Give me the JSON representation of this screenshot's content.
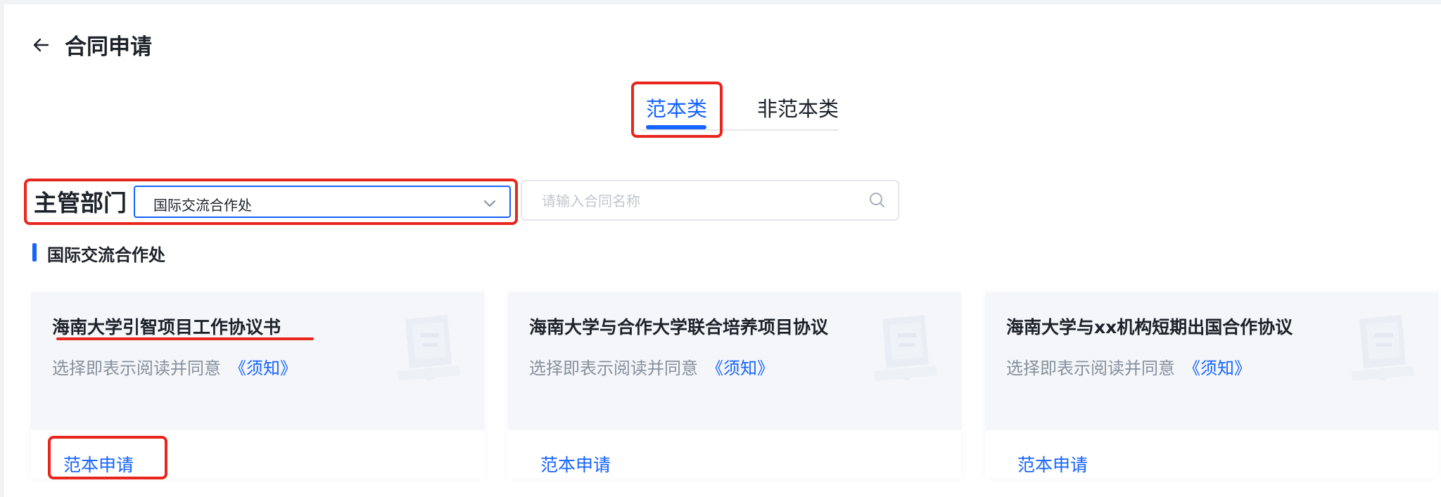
{
  "header": {
    "title": "合同申请"
  },
  "tabs": [
    {
      "label": "范本类",
      "active": true
    },
    {
      "label": "非范本类",
      "active": false
    }
  ],
  "filter": {
    "label": "主管部门",
    "selected_department": "国际交流合作处",
    "search_placeholder": "请输入合同名称"
  },
  "section": {
    "title": "国际交流合作处"
  },
  "cards": [
    {
      "title": "海南大学引智项目工作协议书",
      "notice_text": "选择即表示阅读并同意",
      "notice_link": "《须知》",
      "apply_label": "范本申请"
    },
    {
      "title": "海南大学与合作大学联合培养项目协议",
      "notice_text": "选择即表示阅读并同意",
      "notice_link": "《须知》",
      "apply_label": "范本申请"
    },
    {
      "title": "海南大学与xx机构短期出国合作协议",
      "notice_text": "选择即表示阅读并同意",
      "notice_link": "《须知》",
      "apply_label": "范本申请"
    }
  ],
  "colors": {
    "accent": "#1664ff",
    "annotation": "#e8261d",
    "text_primary": "#1d2129",
    "text_secondary": "#86909c"
  },
  "icons": [
    "arrow-left-icon",
    "chevron-down-icon",
    "search-icon",
    "doc-illustration-icon"
  ]
}
